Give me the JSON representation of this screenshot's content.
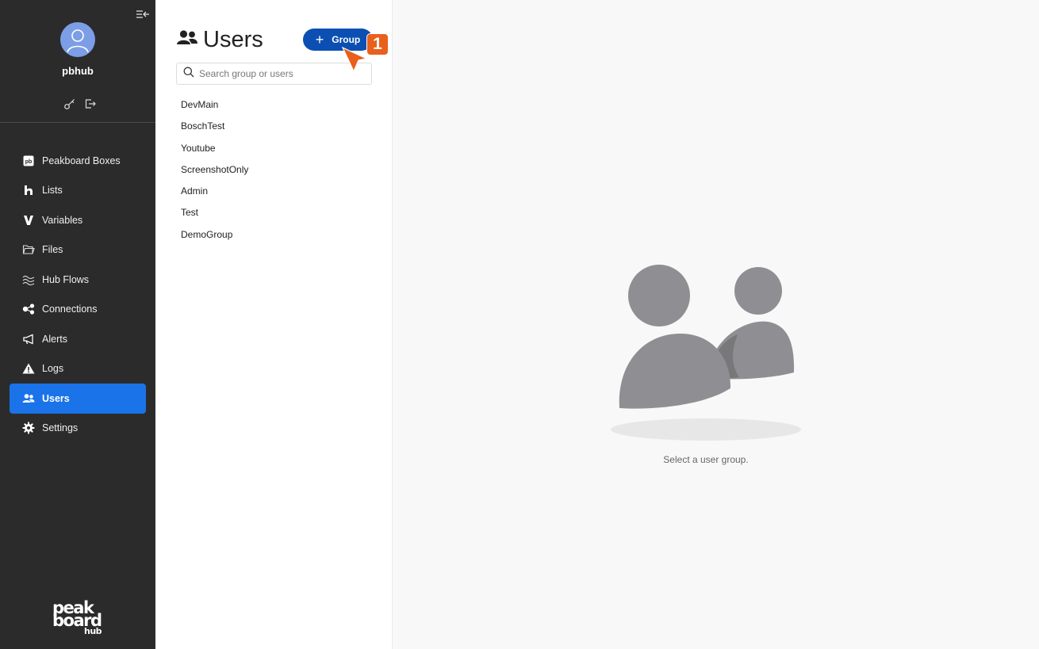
{
  "sidebar": {
    "username": "pbhub",
    "items": [
      {
        "label": "Peakboard Boxes",
        "icon": "pb-box-icon"
      },
      {
        "label": "Lists",
        "icon": "lists-icon"
      },
      {
        "label": "Variables",
        "icon": "variables-icon"
      },
      {
        "label": "Files",
        "icon": "folder-icon"
      },
      {
        "label": "Hub Flows",
        "icon": "waves-icon"
      },
      {
        "label": "Connections",
        "icon": "connections-icon"
      },
      {
        "label": "Alerts",
        "icon": "megaphone-icon"
      },
      {
        "label": "Logs",
        "icon": "warning-icon"
      },
      {
        "label": "Users",
        "icon": "users-icon",
        "active": true
      },
      {
        "label": "Settings",
        "icon": "gear-icon"
      }
    ],
    "logo": {
      "line1": "peak",
      "line2": "board",
      "line3": "hub"
    }
  },
  "groups_panel": {
    "title": "Users",
    "add_button_label": "Group",
    "search_placeholder": "Search group or users",
    "groups": [
      "DevMain",
      "BoschTest",
      "Youtube",
      "ScreenshotOnly",
      "Admin",
      "Test",
      "DemoGroup"
    ]
  },
  "annotation": {
    "step": "1"
  },
  "main": {
    "empty_text": "Select a user group."
  },
  "colors": {
    "sidebar_bg": "#2b2b2b",
    "accent": "#1a73e8",
    "button": "#0b4fb3",
    "marker": "#e8601c"
  }
}
